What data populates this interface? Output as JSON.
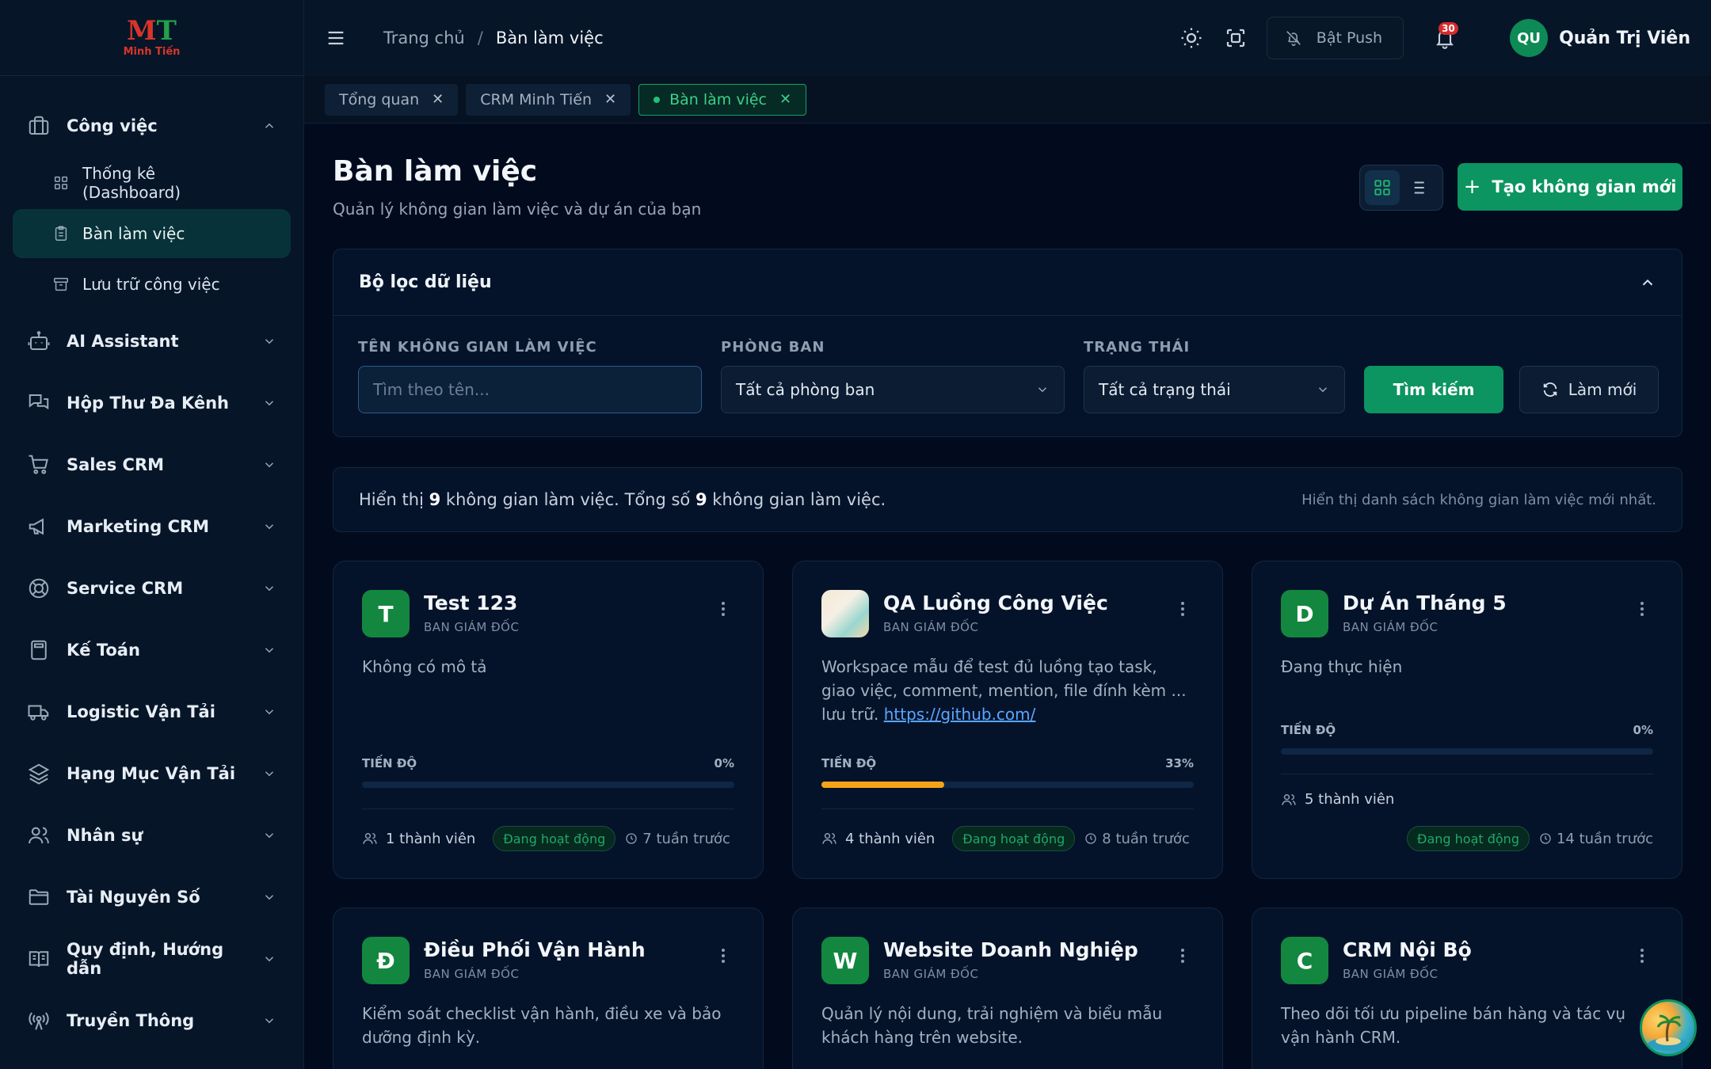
{
  "brand": {
    "logo_mark": "MT",
    "logo_text": "Minh Tiến"
  },
  "sidebar": {
    "groups": [
      {
        "label": "Công việc",
        "icon": "briefcase-icon",
        "expanded": true,
        "items": [
          {
            "label": "Thống kê (Dashboard)",
            "icon": "dashboard-icon",
            "active": false
          },
          {
            "label": "Bàn làm việc",
            "icon": "clipboard-icon",
            "active": true
          },
          {
            "label": "Lưu trữ công việc",
            "icon": "archive-icon",
            "active": false
          }
        ]
      },
      {
        "label": "AI Assistant",
        "icon": "robot-icon"
      },
      {
        "label": "Hộp Thư Đa Kênh",
        "icon": "chat-icon"
      },
      {
        "label": "Sales CRM",
        "icon": "cart-icon"
      },
      {
        "label": "Marketing CRM",
        "icon": "megaphone-icon"
      },
      {
        "label": "Service CRM",
        "icon": "lifebuoy-icon"
      },
      {
        "label": "Kế Toán",
        "icon": "calculator-icon"
      },
      {
        "label": "Logistic Vận Tải",
        "icon": "truck-icon"
      },
      {
        "label": "Hạng Mục Vận Tải",
        "icon": "layers-icon"
      },
      {
        "label": "Nhân sự",
        "icon": "users-icon"
      },
      {
        "label": "Tài Nguyên Số",
        "icon": "folder-icon"
      },
      {
        "label": "Quy định, Hướng dẫn",
        "icon": "book-icon"
      },
      {
        "label": "Truyền Thông",
        "icon": "broadcast-icon"
      }
    ]
  },
  "header": {
    "breadcrumb": {
      "home": "Trang chủ",
      "separator": "/",
      "current": "Bàn làm việc"
    },
    "push_label": "Bật Push",
    "notification_count": "30",
    "user": {
      "initials": "QU",
      "name": "Quản Trị Viên"
    }
  },
  "tabs": [
    {
      "label": "Tổng quan",
      "active": false
    },
    {
      "label": "CRM Minh Tiến",
      "active": false
    },
    {
      "label": "Bàn làm việc",
      "active": true
    }
  ],
  "page": {
    "title": "Bàn làm việc",
    "subtitle": "Quản lý không gian làm việc và dự án của bạn",
    "new_button": "Tạo không gian mới"
  },
  "filter": {
    "title": "Bộ lọc dữ liệu",
    "name_label": "TÊN KHÔNG GIAN LÀM VIỆC",
    "name_placeholder": "Tìm theo tên...",
    "dept_label": "PHÒNG BAN",
    "dept_value": "Tất cả phòng ban",
    "status_label": "TRẠNG THÁI",
    "status_value": "Tất cả trạng thái",
    "search_button": "Tìm kiếm",
    "reset_button": "Làm mới"
  },
  "summary": {
    "prefix": "Hiển thị",
    "shown": "9",
    "middle": "không gian làm việc. Tổng số",
    "total": "9",
    "suffix": "không gian làm việc.",
    "note": "Hiển thị danh sách không gian làm việc mới nhất."
  },
  "workspaces": [
    {
      "initial": "T",
      "name": "Test 123",
      "dept": "BAN GIÁM ĐỐC",
      "desc": "Không có mô tả",
      "progress_label": "TIẾN ĐỘ",
      "progress": 0,
      "progress_text": "0%",
      "members": "1 thành viên",
      "status": "Đang hoạt động",
      "time": "7 tuần trước"
    },
    {
      "initial": "",
      "name": "QA Luồng Công Việc",
      "dept": "BAN GIÁM ĐỐC",
      "desc": "Workspace mẫu để test đủ luồng tạo task, giao việc, comment, mention, file đính kèm ...",
      "desc2": "lưu trữ.",
      "link": "https://github.com/",
      "progress_label": "TIẾN ĐỘ",
      "progress": 33,
      "progress_text": "33%",
      "members": "4 thành viên",
      "status": "Đang hoạt động",
      "time": "8 tuần trước"
    },
    {
      "initial": "D",
      "name": "Dự Án Tháng 5",
      "dept": "BAN GIÁM ĐỐC",
      "desc": "Đang thực hiện",
      "progress_label": "TIẾN ĐỘ",
      "progress": 0,
      "progress_text": "0%",
      "members": "5 thành viên",
      "status": "Đang hoạt động",
      "time": "14 tuần trước"
    },
    {
      "initial": "Đ",
      "name": "Điều Phối Vận Hành",
      "dept": "BAN GIÁM ĐỐC",
      "desc": "Kiểm soát checklist vận hành, điều xe và bảo dưỡng định kỳ."
    },
    {
      "initial": "W",
      "name": "Website Doanh Nghiệp",
      "dept": "BAN GIÁM ĐỐC",
      "desc": "Quản lý nội dung, trải nghiệm và biểu mẫu khách hàng trên website."
    },
    {
      "initial": "C",
      "name": "CRM Nội Bộ",
      "dept": "BAN GIÁM ĐỐC",
      "desc": "Theo dõi tối ưu pipeline bán hàng và tác vụ vận hành CRM."
    }
  ],
  "colors": {
    "accent": "#0c9461",
    "progress": "#f5a418",
    "background": "#020b1e",
    "sidebar": "#071528"
  }
}
